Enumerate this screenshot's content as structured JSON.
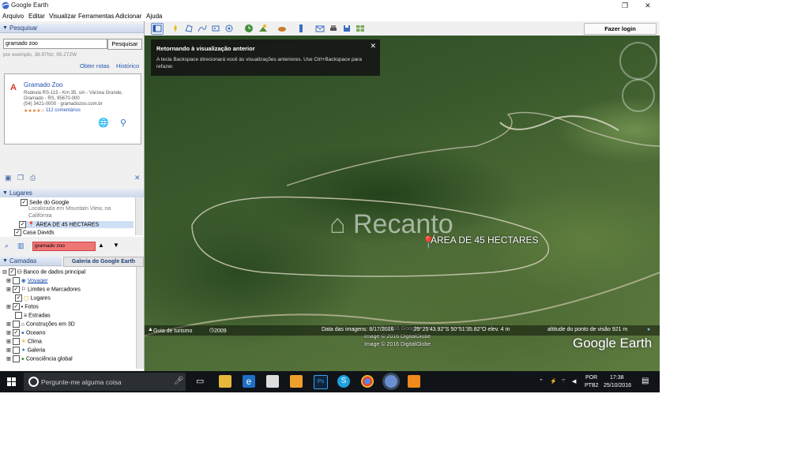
{
  "window": {
    "title": "Google Earth",
    "restore_symbol": "❐",
    "close_symbol": "✕"
  },
  "menu": [
    "Arquivo",
    "Editar",
    "Visualizar",
    "Ferramentas",
    "Adicionar",
    "Ajuda"
  ],
  "toolbar": {
    "login_label": "Fazer login"
  },
  "search_panel": {
    "header": "Pesquisar",
    "query": "gramado zoo",
    "button": "Pesquisar",
    "hint": "por exemplo, 38.97Nz, 95.272W",
    "route_link": "Obter rotas",
    "history_link": "Histórico",
    "result": {
      "marker": "A",
      "name": "Gramado Zoo",
      "address1": "Rodovia RS-115 - Km 35, s/n - Várzea Grande,",
      "address2": "Gramado - RS, 95670-000",
      "phone": "(54) 3421-0000 · gramadozoo.com.br",
      "stars": "★★★★☆",
      "reviews": "112 comentários"
    }
  },
  "places_panel": {
    "header": "Lugares",
    "items": [
      {
        "label": "Sede do Google",
        "checked": true
      },
      {
        "label": "Localizada em Mountain View, na",
        "checked": null
      },
      {
        "label": "Califórnia",
        "checked": null
      },
      {
        "label": "ÁREA DE 45 HECTARES",
        "checked": true
      },
      {
        "label": "Casa Davids",
        "checked": true
      }
    ],
    "search_value": "gramado zoo"
  },
  "layers_panel": {
    "header": "Camadas",
    "gallery_button": "Galeria do Google Earth",
    "items": [
      {
        "label": "Banco de dados principal",
        "checked": true,
        "color": "#2a2a2a"
      },
      {
        "label": "Voyager",
        "checked": false,
        "color": "#1d4fb0"
      },
      {
        "label": "Limites e Marcadores",
        "checked": true,
        "color": "#2a2a2a"
      },
      {
        "label": "Lugares",
        "checked": true,
        "color": "#2a2a2a"
      },
      {
        "label": "Fotos",
        "checked": true,
        "color": "#2a2a2a"
      },
      {
        "label": "Estradas",
        "checked": false,
        "color": "#2a2a2a"
      },
      {
        "label": "Construções em 3D",
        "checked": false,
        "color": "#2a2a2a"
      },
      {
        "label": "Oceano",
        "checked": true,
        "color": "#2a2a2a"
      },
      {
        "label": "Clima",
        "checked": false,
        "color": "#2a2a2a"
      },
      {
        "label": "Galeria",
        "checked": false,
        "color": "#2a2a2a"
      },
      {
        "label": "Consciência global",
        "checked": false,
        "color": "#2a2a2a"
      }
    ]
  },
  "map": {
    "notice_title": "Retornando à visualização anterior",
    "notice_text": "A tecla Backspace direcionará você às visualizações anteriores. Use Ctrl+Backspace para refazer.",
    "watermark": "Recanto",
    "placemark_label": "ÁREA DE 45 HECTARES",
    "credit1": "© 2016 Google",
    "credit2": "Image © 2016 DigitalGlobe",
    "credit3": "Image © 2016 DigitalGlobe",
    "brand": "Google Earth",
    "status_tour": "Guia de turismo",
    "status_year": "2009",
    "status_date": "Data das imagens: 8/17/2016",
    "status_coords": "29°25'43.92\"S  50°51'35.82\"O  elev.  4 m",
    "status_alt": "altitude do ponto de visão   921 m"
  },
  "taskbar": {
    "search_placeholder": "Pergunte-me alguma coisa",
    "lang1": "POR",
    "lang2": "PTB2",
    "time": "17:38",
    "date": "25/10/2016"
  }
}
